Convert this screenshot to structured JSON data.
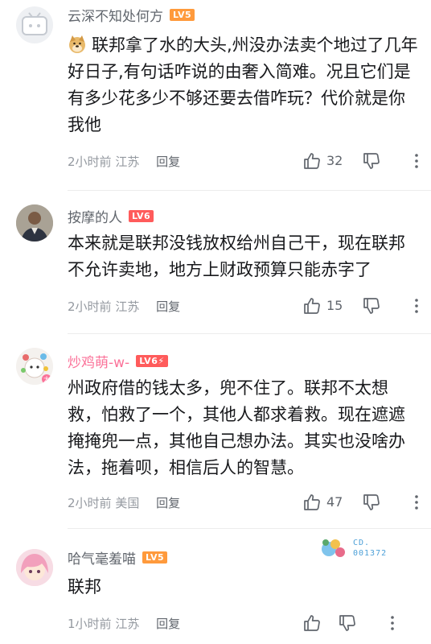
{
  "comments": [
    {
      "username": "云深不知处何方",
      "level": "LV5",
      "text": "联邦拿了水的大头,州没办法卖个地过了几年好日子,有句话咋说的由奢入简难。况且它们是有多少花多少不够还要去借咋玩？代价就是你我他",
      "time": "2小时前",
      "location": "江苏",
      "reply_label": "回复",
      "likes": "32"
    },
    {
      "username": "按摩的人",
      "level": "LV6",
      "text": "本来就是联邦没钱放权给州自己干，现在联邦不允许卖地，地方上财政预算只能赤字了",
      "time": "2小时前",
      "location": "江苏",
      "reply_label": "回复",
      "likes": "15"
    },
    {
      "username": "炒鸡萌-w-",
      "level": "LV6",
      "text": "州政府借的钱太多，兜不住了。联邦不太想救，怕救了一个，其他人都求着救。现在遮遮掩掩兜一点，其他自己想办法。其实也没啥办法，拖着呗，相信后人的智慧。",
      "time": "2小时前",
      "location": "美国",
      "reply_label": "回复",
      "likes": "47"
    },
    {
      "username": "哈气毫羞喵",
      "level": "LV5",
      "text": "联邦",
      "time": "1小时前",
      "location": "江苏",
      "reply_label": "回复",
      "likes": "",
      "sticker_text": "CD.\n001372"
    }
  ],
  "icons": {
    "like": "thumbs-up-icon",
    "dislike": "thumbs-down-icon",
    "more": "more-vertical-icon"
  },
  "colors": {
    "pink_name": "#fb7299",
    "lv5": "#ff9a3c",
    "lv6": "#ff5b5b"
  }
}
